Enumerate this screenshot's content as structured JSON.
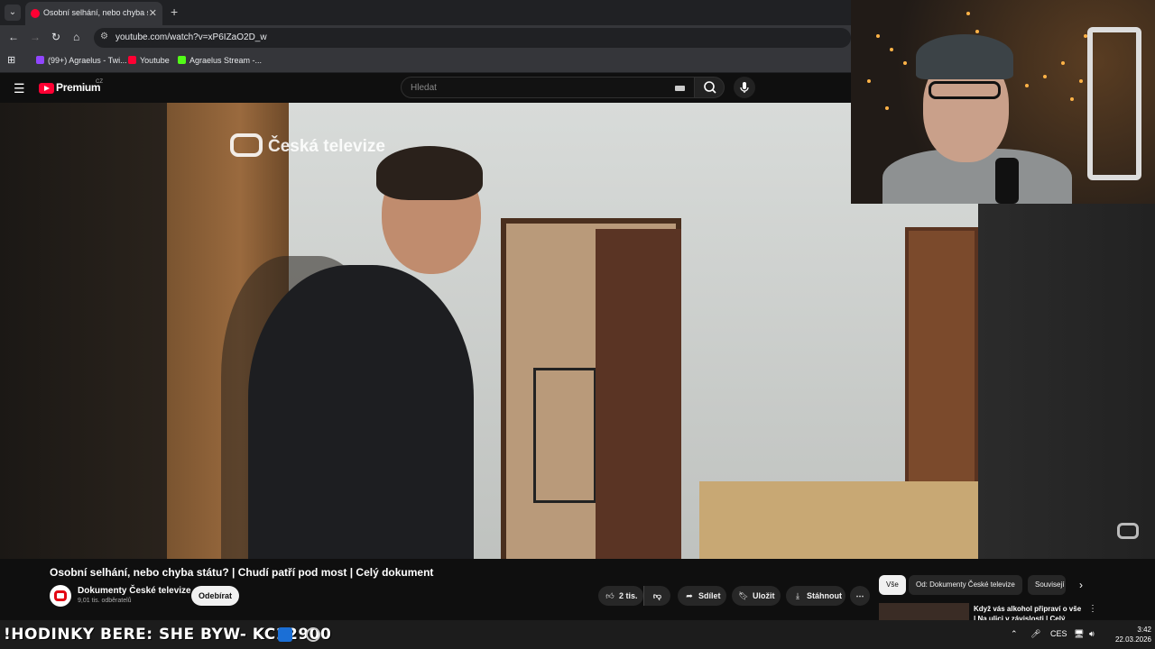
{
  "browser": {
    "tab_title": "Osobní selhání, nebo chyba stát",
    "tab_close": "✕",
    "new_tab": "+",
    "url": "youtube.com/watch?v=xP6IZaO2D_w",
    "bookmarks": [
      {
        "label": "(99+) Agraelus - Twi...",
        "color": "#9146ff"
      },
      {
        "label": "Youtube",
        "color": "#ff0033"
      },
      {
        "label": "Agraelus Stream -...",
        "color": "#53fc18"
      }
    ]
  },
  "youtube": {
    "logo_text": "Premium",
    "country": "CZ",
    "search_placeholder": "Hledat"
  },
  "video": {
    "broadcaster_logo": "Česká televize",
    "title": "Osobní selhání, nebo chyba státu? | Chudí patří pod most | Celý dokument",
    "channel_name": "Dokumenty České televize",
    "subscribers": "9,01 tis. odběratelů",
    "subscribe_label": "Odebírat",
    "likes": "2 tis.",
    "share_label": "Sdílet",
    "save_label": "Uložit",
    "download_label": "Stáhnout",
    "more": "⋯"
  },
  "sidebar": {
    "chips": [
      "Vše",
      "Od: Dokumenty České televize",
      "Souvisejí"
    ],
    "rec_title": "Když vás alkohol připraví o vše | Na ulici v závislosti | Celý"
  },
  "taskbar": {
    "ticker": "!HODINKY BERE: SHE  BYW- KC12900",
    "lang": "CES",
    "time": "3:42",
    "date": "22.03.2026"
  },
  "colors": {
    "youtube_red": "#ff0033",
    "background": "#0f0f0f",
    "pill": "#272727"
  }
}
